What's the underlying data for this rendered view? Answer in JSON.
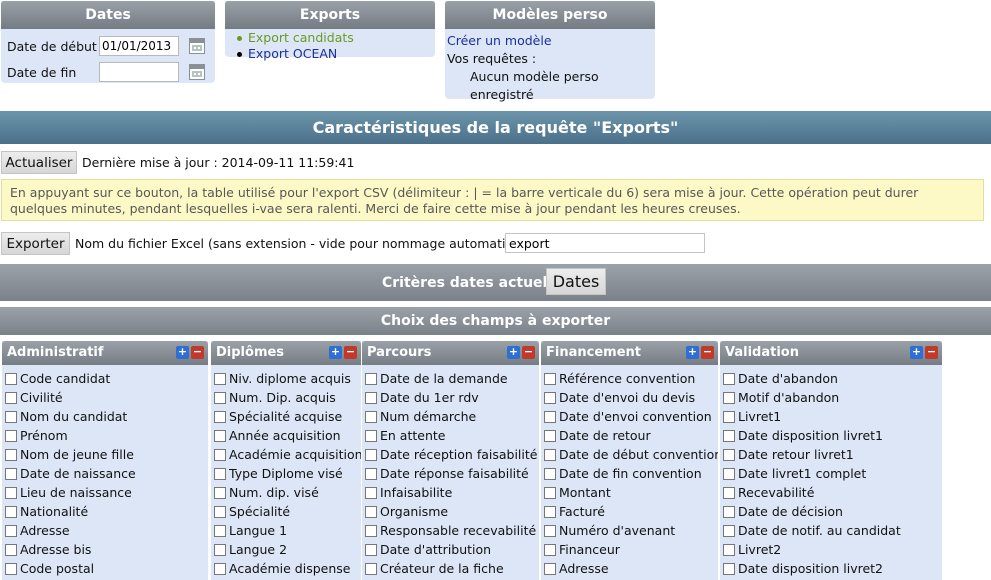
{
  "dates_panel": {
    "title": "Dates",
    "start_label": "Date de début",
    "start_value": "01/01/2013",
    "end_label": "Date de fin",
    "end_value": ""
  },
  "exports_panel": {
    "title": "Exports",
    "items": [
      "Export candidats",
      "Export OCEAN"
    ],
    "colors": {
      "active": "#6b9a23",
      "link": "#1b2f9e"
    }
  },
  "models_panel": {
    "title": "Modèles perso",
    "create_link": "Créer un modèle",
    "requests_label": "Vos requêtes :",
    "empty_text": "Aucun modèle perso enregistré"
  },
  "main_title": "Caractéristiques de la requête \"Exports\"",
  "refresh": {
    "button": "Actualiser",
    "last_update": "Dernière mise à jour : 2014-09-11 11:59:41"
  },
  "notice": "En appuyant sur ce bouton, la table utilisé pour l'export CSV (délimiteur : | = la barre verticale du 6) sera mise à jour. Cette opération peut durer quelques minutes, pendant lesquelles i-vae sera ralenti. Merci de faire cette mise à jour pendant les heures creuses.",
  "export": {
    "button": "Exporter",
    "filename_label": "Nom du fichier Excel (sans extension - vide pour nommage automatique)",
    "filename_value": "export"
  },
  "dates_criteria": {
    "title": "Critères dates actuels",
    "button": "Dates"
  },
  "fields_title": "Choix des champs à exporter",
  "columns": [
    {
      "title": "Administratif",
      "items": [
        "Code candidat",
        "Civilité",
        "Nom du candidat",
        "Prénom",
        "Nom de jeune fille",
        "Date de naissance",
        "Lieu de naissance",
        "Nationalité",
        "Adresse",
        "Adresse bis",
        "Code postal"
      ]
    },
    {
      "title": "Diplômes",
      "items": [
        "Niv. diplome acquis",
        "Num. Dip. acquis",
        "Spécialité acquise",
        "Année acquisition",
        "Académie acquisition",
        "Type Diplome visé",
        "Num. dip. visé",
        "Spécialité",
        "Langue 1",
        "Langue 2",
        "Académie dispense"
      ]
    },
    {
      "title": "Parcours",
      "items": [
        "Date de la demande",
        "Date du 1er rdv",
        "Num démarche",
        "En attente",
        "Date réception faisabilité",
        "Date réponse faisabilité",
        "Infaisabilite",
        "Organisme",
        "Responsable recevabilité",
        "Date d'attribution",
        "Créateur de la fiche"
      ]
    },
    {
      "title": "Financement",
      "items": [
        "Référence convention",
        "Date d'envoi du devis",
        "Date d'envoi convention",
        "Date de retour",
        "Date de début convention",
        "Date de fin convention",
        "Montant",
        "Facturé",
        "Numéro d'avenant",
        "Financeur",
        "Adresse"
      ]
    },
    {
      "title": "Validation",
      "items": [
        "Date d'abandon",
        "Motif d'abandon",
        "Livret1",
        "Date disposition livret1",
        "Date retour livret1",
        "Date livret1 complet",
        "Recevabilité",
        "Date de décision",
        "Date de notif. au candidat",
        "Livret2",
        "Date disposition livret2"
      ]
    }
  ]
}
